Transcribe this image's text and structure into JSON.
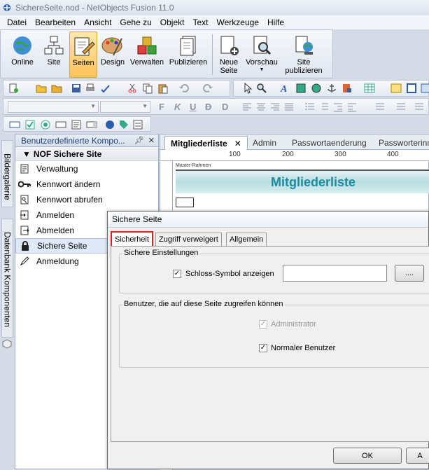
{
  "window": {
    "title": "SichereSeite.nod - NetObjects Fusion 11.0"
  },
  "menu": [
    "Datei",
    "Bearbeiten",
    "Ansicht",
    "Gehe zu",
    "Objekt",
    "Text",
    "Werkzeuge",
    "Hilfe"
  ],
  "bigtoolbar": {
    "online": "Online",
    "site": "Site",
    "seiten": "Seiten",
    "design": "Design",
    "verwalten": "Verwalten",
    "publizieren": "Publizieren",
    "neue_seite_1": "Neue",
    "neue_seite_2": "Seite",
    "vorschau": "Vorschau",
    "site_publizieren_1": "Site",
    "site_publizieren_2": "publizieren"
  },
  "format_bar": {
    "bold": "F",
    "italic": "K",
    "underline": "U",
    "strike": "D",
    "sub": "D"
  },
  "side_tabs": {
    "bildergalerie": "Bildergalerie",
    "datenbank": "Datenbank Komponenten"
  },
  "panel": {
    "title": "Benutzerdefinierte Kompo...",
    "group": "NOF Sichere Site",
    "items": [
      "Verwaltung",
      "Kennwort ändern",
      "Kennwort abrufen",
      "Anmelden",
      "Abmelden",
      "Sichere Seite",
      "Anmeldung"
    ]
  },
  "doc_tabs": [
    "Mitgliederliste",
    "Admin",
    "Passwortaenderung",
    "Passworterinn"
  ],
  "ruler": [
    "100",
    "200",
    "300",
    "400"
  ],
  "page": {
    "master": "Master-Rahmen",
    "banner": "Mitgliederliste"
  },
  "dialog": {
    "title": "Sichere Seite",
    "tabs": [
      "Sicherheit",
      "Zugriff verweigert",
      "Allgemein"
    ],
    "group1": "Sichere Einstellungen",
    "lock_label": "Schloss-Symbol anzeigen",
    "browse": "....",
    "group2": "Benutzer, die auf diese Seite zugreifen können",
    "admin": "Administrator",
    "normal": "Normaler Benutzer",
    "ok": "OK",
    "cancel": "A"
  }
}
